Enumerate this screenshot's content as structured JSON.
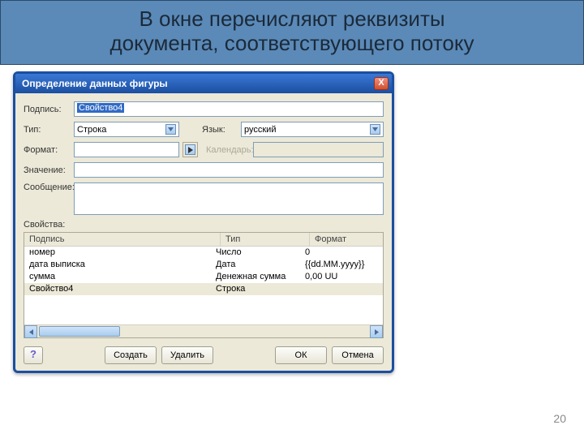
{
  "slide": {
    "header_line1": "В окне перечисляют реквизиты",
    "header_line2": "документа, соответствующего потоку",
    "page_number": "20"
  },
  "dialog": {
    "title": "Определение данных фигуры",
    "close_x": "X",
    "labels": {
      "caption": "Подпись:",
      "type": "Тип:",
      "language": "Язык:",
      "format": "Формат:",
      "calendar": "Календарь:",
      "value": "Значение:",
      "message": "Сообщение:",
      "properties": "Свойства:"
    },
    "fields": {
      "caption_value": "Свойство4",
      "type_value": "Строка",
      "language_value": "русский",
      "format_value": "",
      "calendar_value": "",
      "value_value": "",
      "message_value": ""
    },
    "grid": {
      "headers": {
        "caption": "Подпись",
        "type": "Тип",
        "format": "Формат"
      },
      "rows": [
        {
          "caption": "номер",
          "type": "Число",
          "format": "0"
        },
        {
          "caption": "дата выписка",
          "type": "Дата",
          "format": "{{dd.MM.yyyy}}"
        },
        {
          "caption": "сумма",
          "type": "Денежная сумма",
          "format": "0,00 UU"
        },
        {
          "caption": "Свойство4",
          "type": "Строка",
          "format": ""
        }
      ]
    },
    "buttons": {
      "help": "?",
      "create": "Создать",
      "delete": "Удалить",
      "ok": "ОК",
      "cancel": "Отмена"
    }
  }
}
